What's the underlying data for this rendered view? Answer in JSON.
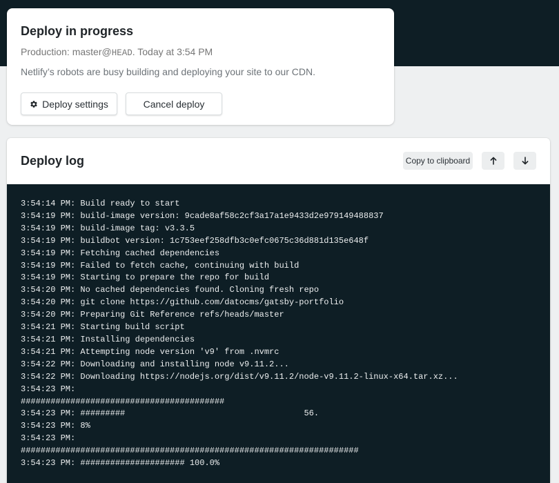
{
  "deploy": {
    "title": "Deploy in progress",
    "meta_prefix": "Production: master@",
    "meta_ref": "HEAD",
    "meta_suffix": ". Today at 3:54 PM",
    "description": "Netlify’s robots are busy building and deploying your site to our CDN.",
    "settings_label": "Deploy settings",
    "cancel_label": "Cancel deploy",
    "settings_icon": "gear-icon"
  },
  "log": {
    "title": "Deploy log",
    "copy_label": "Copy to clipboard",
    "scroll_up_icon": "arrow-up-icon",
    "scroll_down_icon": "arrow-down-icon",
    "lines": [
      "3:54:14 PM: Build ready to start",
      "3:54:19 PM: build-image version: 9cade8af58c2cf3a17a1e9433d2e979149488837",
      "3:54:19 PM: build-image tag: v3.3.5",
      "3:54:19 PM: buildbot version: 1c753eef258dfb3c0efc0675c36d881d135e648f",
      "3:54:19 PM: Fetching cached dependencies",
      "3:54:19 PM: Failed to fetch cache, continuing with build",
      "3:54:19 PM: Starting to prepare the repo for build",
      "3:54:20 PM: No cached dependencies found. Cloning fresh repo",
      "3:54:20 PM: git clone https://github.com/datocms/gatsby-portfolio",
      "3:54:20 PM: Preparing Git Reference refs/heads/master",
      "3:54:21 PM: Starting build script",
      "3:54:21 PM: Installing dependencies",
      "3:54:21 PM: Attempting node version 'v9' from .nvmrc",
      "3:54:22 PM: Downloading and installing node v9.11.2...",
      "3:54:22 PM: Downloading https://nodejs.org/dist/v9.11.2/node-v9.11.2-linux-x64.tar.xz...",
      "3:54:23 PM:",
      "#########################################",
      "3:54:23 PM: #########                                    56.",
      "3:54:23 PM: 8%",
      "3:54:23 PM:",
      "####################################################################",
      "3:54:23 PM: ##################### 100.0%"
    ]
  },
  "colors": {
    "dark_band": "#0e1e25",
    "page_bg": "#eef0f1",
    "log_text": "#eceeef"
  }
}
